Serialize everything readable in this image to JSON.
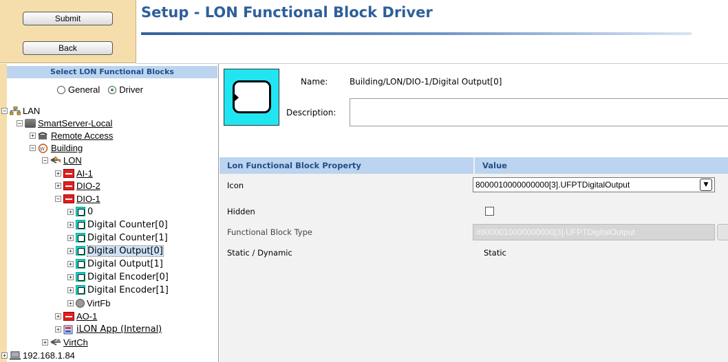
{
  "header": {
    "title": "Setup - LON Functional Block Driver",
    "submit_label": "Submit",
    "back_label": "Back"
  },
  "left_panel": {
    "heading": "Select LON Functional Blocks",
    "radio_general": "General",
    "radio_driver": "Driver",
    "radio_selected": "Driver",
    "tree": {
      "lan": "LAN",
      "smartserver": "SmartServer-Local",
      "remote_access": "Remote Access",
      "building": "Building",
      "lon": "LON",
      "ai1": "AI-1",
      "dio2": "DIO-2",
      "dio1": "DIO-1",
      "fb0": "0",
      "counter0": "Digital Counter[0]",
      "counter1": "Digital Counter[1]",
      "output0": "Digital Output[0]",
      "output1": "Digital Output[1]",
      "encoder0": "Digital Encoder[0]",
      "encoder1": "Digital Encoder[1]",
      "virtfb": "VirtFb",
      "ao1": "AO-1",
      "ilon_app": "iLON App (Internal)",
      "virtch": "VirtCh",
      "ip": "192.168.1.84"
    }
  },
  "detail": {
    "name_label": "Name:",
    "name_value": "Building/LON/DIO-1/Digital Output[0]",
    "description_label": "Description:",
    "description_value": ""
  },
  "properties": {
    "col_property": "Lon Functional Block Property",
    "col_value": "Value",
    "icon_label": "Icon",
    "icon_value": "8000010000000000[3].UFPTDigitalOutput",
    "hidden_label": "Hidden",
    "hidden_checked": false,
    "fbtype_label": "Functional Block Type",
    "fbtype_value": "#8000010000000000[3].UFPTDigitalOutput",
    "static_label": "Static / Dynamic",
    "static_value": "Static"
  },
  "colors": {
    "title": "#2e5f9b",
    "panel_header_bg": "#bcd4ef",
    "sidebar_tan": "#f5deab",
    "fb_icon_cyan": "#21e6f2"
  }
}
